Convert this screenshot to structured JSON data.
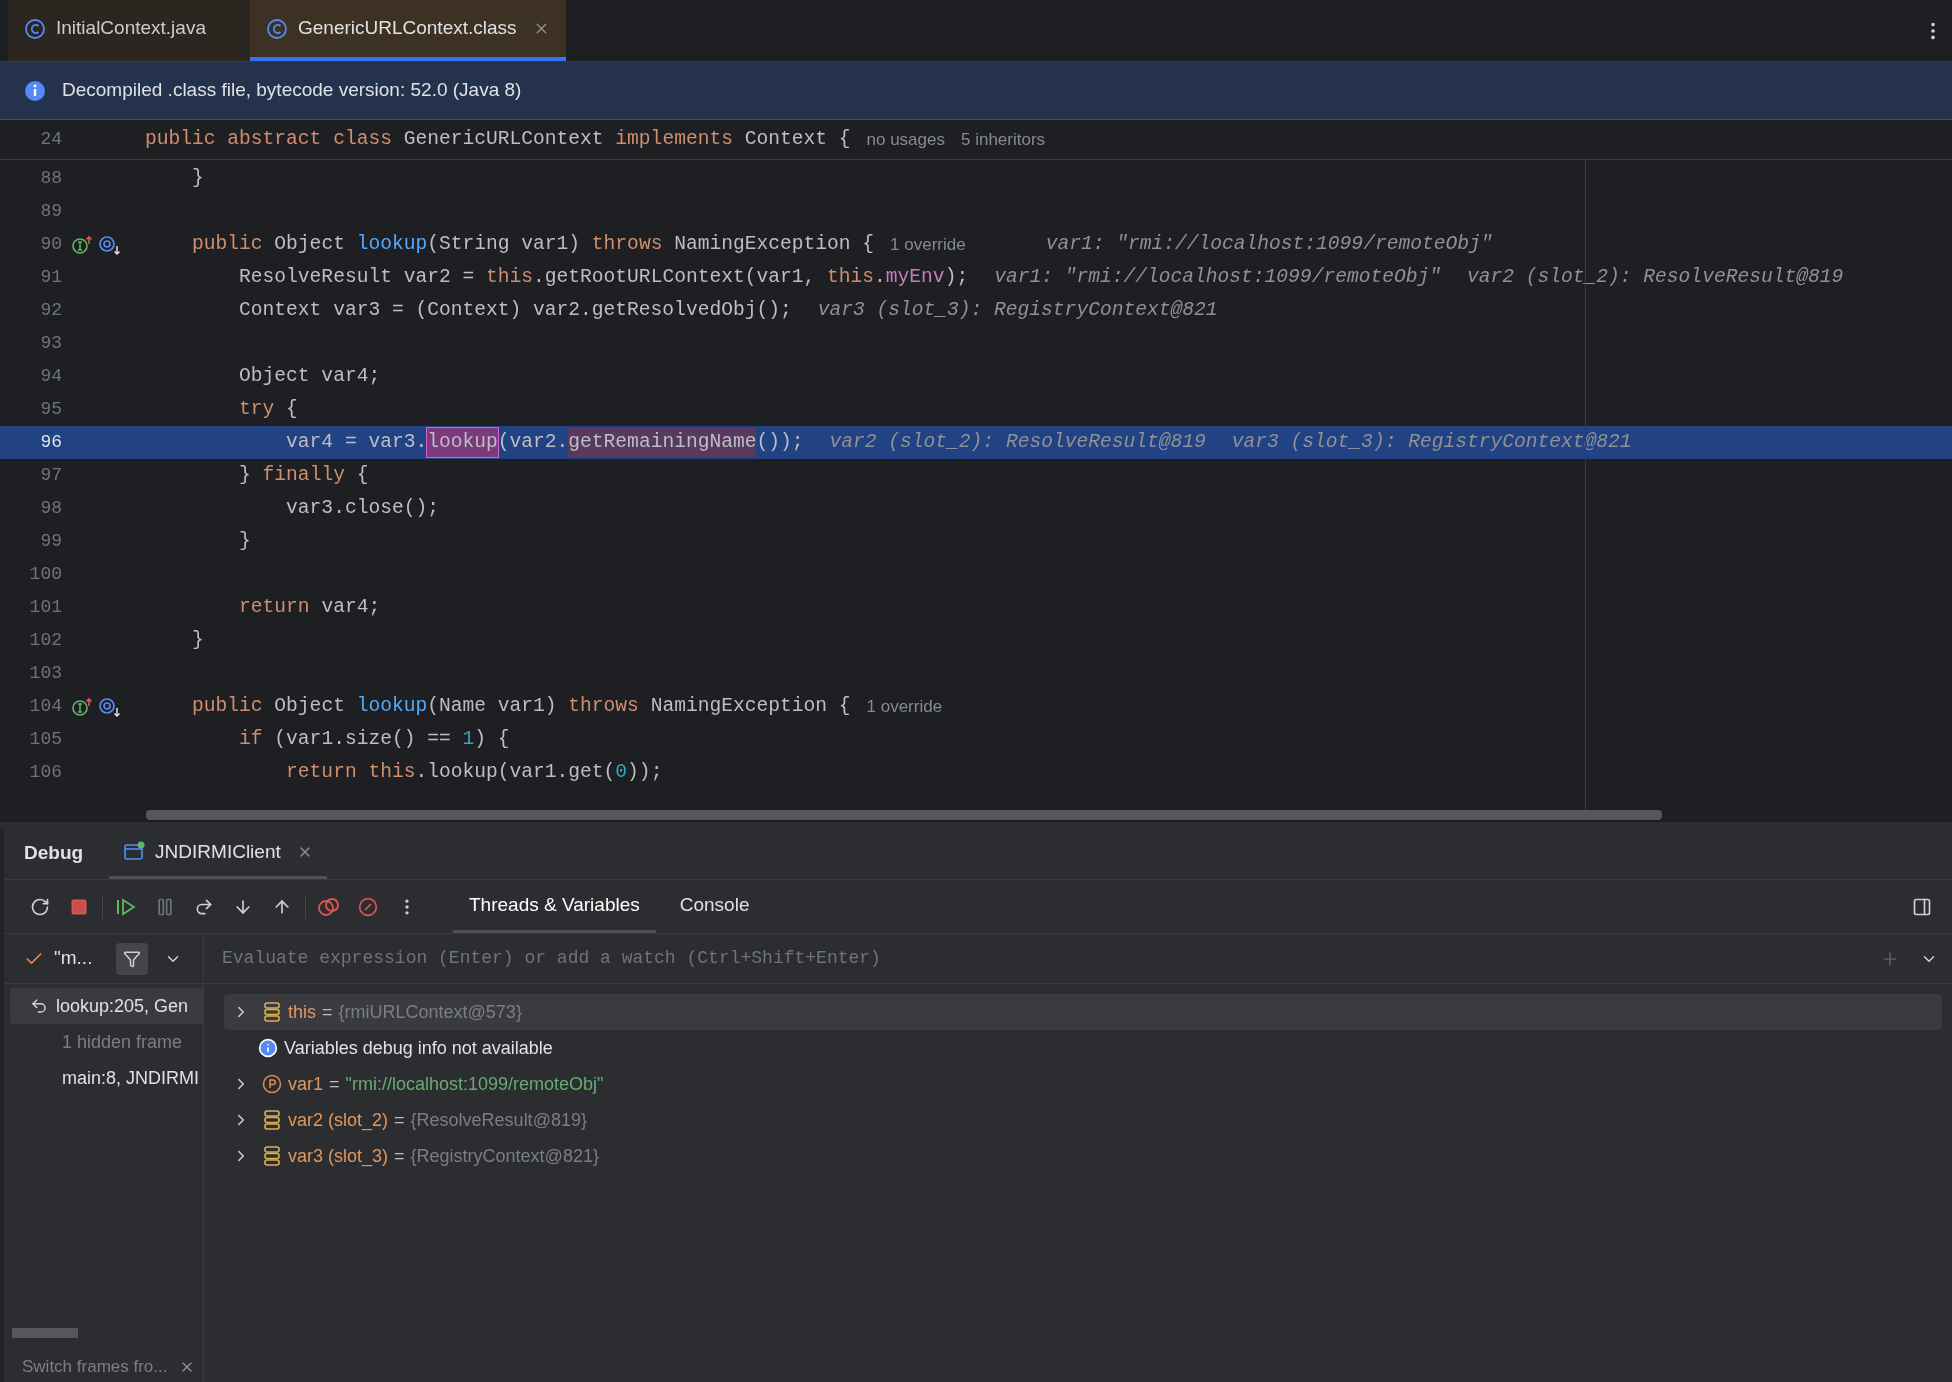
{
  "tabs": [
    {
      "label": "InitialContext.java",
      "selected": false
    },
    {
      "label": "GenericURLContext.class",
      "selected": true
    }
  ],
  "banner": {
    "text": "Decompiled .class file, bytecode version: 52.0 (Java 8)"
  },
  "sticky_line": {
    "number": "24",
    "tokens": [
      {
        "text": "public abstract class ",
        "kind": "kw"
      },
      {
        "text": "GenericURLContext ",
        "kind": "plain"
      },
      {
        "text": "implements ",
        "kind": "kw"
      },
      {
        "text": "Context {",
        "kind": "plain"
      },
      {
        "text": "no usages",
        "kind": "inlay"
      },
      {
        "text": "5 inheritors",
        "kind": "inlay"
      }
    ]
  },
  "lines": [
    {
      "number": "88",
      "current": false,
      "tokens": [
        {
          "text": "    }",
          "kind": "plain"
        }
      ]
    },
    {
      "number": "89",
      "current": false
    },
    {
      "number": "90",
      "current": false,
      "gutter": [
        {
          "kind": "implements"
        },
        {
          "kind": "overridden"
        }
      ],
      "tokens": [
        {
          "text": "    public ",
          "kind": "kw"
        },
        {
          "text": "Object ",
          "kind": "plain"
        },
        {
          "text": "lookup",
          "kind": "fn"
        },
        {
          "text": "(String var1) ",
          "kind": "plain"
        },
        {
          "text": "throws ",
          "kind": "kw"
        },
        {
          "text": "NamingException {",
          "kind": "plain"
        },
        {
          "text": "1 override",
          "kind": "inlay"
        },
        {
          "text": "var1: \"rmi://localhost:1099/remoteObj\"",
          "kind": "hint"
        }
      ]
    },
    {
      "number": "91",
      "current": false,
      "tokens": [
        {
          "text": "        ResolveResult var2 = ",
          "kind": "plain"
        },
        {
          "text": "this",
          "kind": "kw"
        },
        {
          "text": ".getRootURLContext(var1, ",
          "kind": "plain"
        },
        {
          "text": "this",
          "kind": "kw"
        },
        {
          "text": ".",
          "kind": "plain"
        },
        {
          "text": "myEnv",
          "kind": "field"
        },
        {
          "text": ");",
          "kind": "plain"
        },
        {
          "text": "var1: \"rmi://localhost:1099/remoteObj\"",
          "kind": "hint"
        },
        {
          "text": "var2 (slot_2): ResolveResult@819",
          "kind": "hint"
        }
      ]
    },
    {
      "number": "92",
      "current": false,
      "tokens": [
        {
          "text": "        Context var3 = (Context) var2.getResolvedObj();",
          "kind": "plain"
        },
        {
          "text": "var3 (slot_3): RegistryContext@821",
          "kind": "hint"
        }
      ]
    },
    {
      "number": "93",
      "current": false
    },
    {
      "number": "94",
      "current": false,
      "tokens": [
        {
          "text": "        Object var4;",
          "kind": "plain"
        }
      ]
    },
    {
      "number": "95",
      "current": false,
      "tokens": [
        {
          "text": "        try ",
          "kind": "kw"
        },
        {
          "text": "{",
          "kind": "plain"
        }
      ]
    },
    {
      "number": "96",
      "current": true,
      "tokens": [
        {
          "text": "            var4 = var3.",
          "kind": "plain"
        },
        {
          "text": "lookup",
          "kind": "match"
        },
        {
          "text": "(var2.",
          "kind": "plain"
        },
        {
          "text": "getRemainingName",
          "kind": "match2"
        },
        {
          "text": "());",
          "kind": "plain"
        },
        {
          "text": "var2 (slot_2): ResolveResult@819",
          "kind": "hint"
        },
        {
          "text": "var3 (slot_3): RegistryContext@821",
          "kind": "hint"
        }
      ]
    },
    {
      "number": "97",
      "current": false,
      "tokens": [
        {
          "text": "        } ",
          "kind": "plain"
        },
        {
          "text": "finally ",
          "kind": "kw"
        },
        {
          "text": "{",
          "kind": "plain"
        }
      ]
    },
    {
      "number": "98",
      "current": false,
      "tokens": [
        {
          "text": "            var3.close();",
          "kind": "plain"
        }
      ]
    },
    {
      "number": "99",
      "current": false,
      "tokens": [
        {
          "text": "        }",
          "kind": "plain"
        }
      ]
    },
    {
      "number": "100",
      "current": false
    },
    {
      "number": "101",
      "current": false,
      "tokens": [
        {
          "text": "        return ",
          "kind": "kw"
        },
        {
          "text": "var4;",
          "kind": "plain"
        }
      ]
    },
    {
      "number": "102",
      "current": false,
      "tokens": [
        {
          "text": "    }",
          "kind": "plain"
        }
      ]
    },
    {
      "number": "103",
      "current": false
    },
    {
      "number": "104",
      "current": false,
      "gutter": [
        {
          "kind": "implements"
        },
        {
          "kind": "overridden"
        }
      ],
      "tokens": [
        {
          "text": "    public ",
          "kind": "kw"
        },
        {
          "text": "Object ",
          "kind": "plain"
        },
        {
          "text": "lookup",
          "kind": "fn"
        },
        {
          "text": "(Name var1) ",
          "kind": "plain"
        },
        {
          "text": "throws ",
          "kind": "kw"
        },
        {
          "text": "NamingException {",
          "kind": "plain"
        },
        {
          "text": "1 override",
          "kind": "inlay"
        }
      ]
    },
    {
      "number": "105",
      "current": false,
      "tokens": [
        {
          "text": "        if ",
          "kind": "kw"
        },
        {
          "text": "(var1.size() == ",
          "kind": "plain"
        },
        {
          "text": "1",
          "kind": "num"
        },
        {
          "text": ") {",
          "kind": "plain"
        }
      ]
    },
    {
      "number": "106",
      "current": false,
      "tokens": [
        {
          "text": "            return this",
          "kind": "kw"
        },
        {
          "text": ".lookup(var1.get(",
          "kind": "plain"
        },
        {
          "text": "0",
          "kind": "num"
        },
        {
          "text": "));",
          "kind": "plain"
        }
      ]
    }
  ],
  "debug": {
    "title": "Debug",
    "session_tab": {
      "label": "JNDIRMIClient",
      "selected": true
    },
    "view_tabs": [
      {
        "label": "Threads & Variables",
        "selected": true
      },
      {
        "label": "Console",
        "selected": false
      }
    ],
    "thread_selector": "\"m...",
    "eval_placeholder": "Evaluate expression (Enter) or add a watch (Ctrl+Shift+Enter)",
    "frames": [
      {
        "kind": "frame",
        "label": "lookup:205, Gen",
        "selected": true
      },
      {
        "kind": "hidden",
        "label": "1 hidden frame",
        "selected": false
      },
      {
        "kind": "frame",
        "label": "main:8, JNDIRMI",
        "selected": false
      }
    ],
    "frames_footer": "Switch frames fro...",
    "variables": [
      {
        "kind": "field",
        "name": "this",
        "op": "=",
        "value": "{rmiURLContext@573}",
        "color": "#7b7e85",
        "selected": true
      },
      {
        "kind": "info",
        "text": "Variables debug info not available"
      },
      {
        "kind": "param",
        "name": "var1",
        "op": "=",
        "value": "\"rmi://localhost:1099/remoteObj\"",
        "color": "#6aab73",
        "selected": false
      },
      {
        "kind": "field",
        "name": "var2 (slot_2)",
        "op": "=",
        "value": "{ResolveResult@819}",
        "color": "#7b7e85",
        "selected": false
      },
      {
        "kind": "field",
        "name": "var3 (slot_3)",
        "op": "=",
        "value": "{RegistryContext@821}",
        "color": "#7b7e85",
        "selected": false
      }
    ]
  }
}
